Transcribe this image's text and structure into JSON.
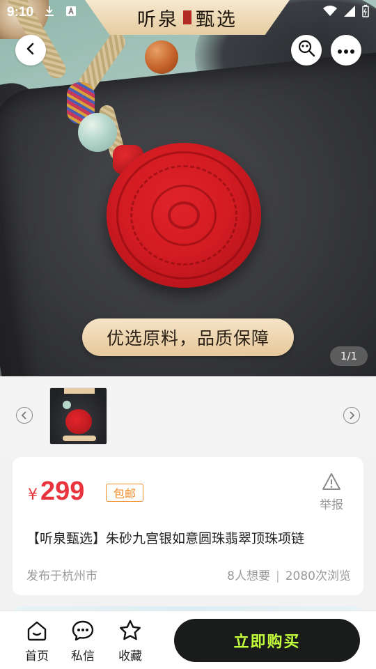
{
  "status_bar": {
    "time": "9:10"
  },
  "brand": {
    "title_left": "听泉",
    "title_right": "甄选"
  },
  "hero": {
    "slogan": "优选原料，品质保障",
    "counter": "1/1"
  },
  "product": {
    "currency": "¥",
    "price": "299",
    "shipping_badge": "包邮",
    "report_label": "举报",
    "title": "【听泉甄选】朱砂九宫银如意圆珠翡翠顶珠项链",
    "location": "发布于杭州市",
    "wants": "8人想要",
    "separator": "|",
    "views": "2080次浏览"
  },
  "bottom_nav": {
    "home": "首页",
    "messages": "私信",
    "favorite": "收藏",
    "buy_now": "立即购买"
  },
  "colors": {
    "price": "#e8343c",
    "badge": "#f08a23",
    "buy_button_bg": "#1a1c1b",
    "buy_button_text": "#c4ff3d"
  },
  "icons": [
    "back-arrow-icon",
    "lens-search-icon",
    "more-icon",
    "chevron-left-icon",
    "chevron-right-icon",
    "warning-icon",
    "home-icon",
    "chat-icon",
    "star-icon",
    "download-icon",
    "wifi-icon",
    "signal-icon",
    "battery-icon"
  ]
}
